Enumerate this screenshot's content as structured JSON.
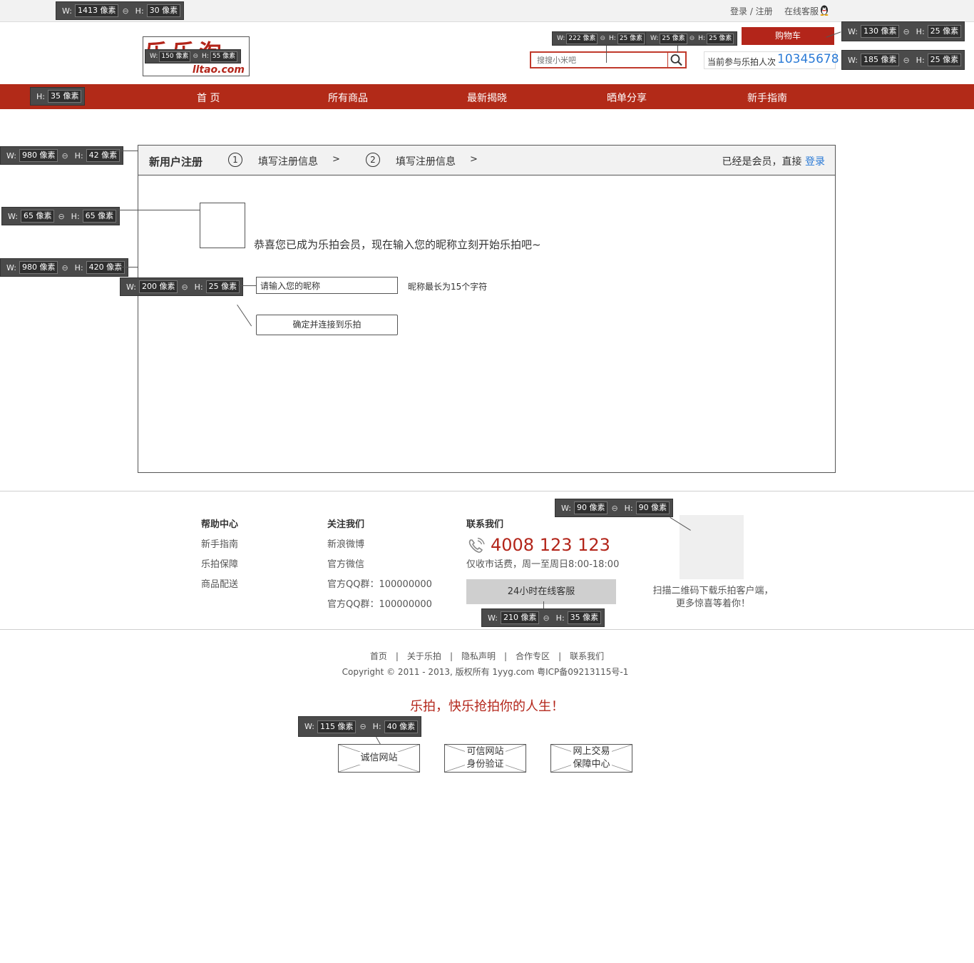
{
  "topbar": {
    "login_register": "登录 / 注册",
    "online_service": "在线客服",
    "qq_icon": "qq-penguin-icon"
  },
  "header": {
    "logo_text": "乐乐淘",
    "logo_domain": "lltao.com",
    "search_placeholder": "搜搜小米吧",
    "search_icon": "magnifier-icon",
    "cart_label": "购物车",
    "count_label": "当前参与乐拍人次",
    "count_value": "10345678"
  },
  "nav": {
    "items": [
      "首 页",
      "所有商品",
      "最新揭晓",
      "晒单分享",
      "新手指南"
    ]
  },
  "register": {
    "title": "新用户注册",
    "steps": [
      {
        "num": "1",
        "label": "填写注册信息",
        "arrow": ">"
      },
      {
        "num": "2",
        "label": "填写注册信息",
        "arrow": ">"
      }
    ],
    "member_note": "已经是会员，直接",
    "login_link": "登录",
    "congrats": "恭喜您已成为乐拍会员，现在输入您的昵称立刻开始乐拍吧~",
    "nickname_value": "请输入您的昵称",
    "nickname_hint": "昵称最长为15个字符",
    "confirm_label": "确定并连接到乐拍"
  },
  "footer": {
    "help": {
      "title": "帮助中心",
      "links": [
        "新手指南",
        "乐拍保障",
        "商品配送"
      ]
    },
    "follow": {
      "title": "关注我们",
      "links": [
        "新浪微博",
        "官方微信",
        "官方QQ群：100000000",
        "官方QQ群：100000000"
      ]
    },
    "contact": {
      "title": "联系我们",
      "phone": "4008 123 123",
      "phone_icon": "phone-icon",
      "note": "仅收市话费，周一至周日8:00-18:00",
      "service_button": "24小时在线客服"
    },
    "qr_text": "扫描二维码下载乐拍客户端，\n更多惊喜等着你！",
    "bottom_links": [
      "首页",
      "关于乐拍",
      "隐私声明",
      "合作专区",
      "联系我们"
    ],
    "separator": "|",
    "copyright": "Copyright © 2011 - 2013, 版权所有 1yyg.com 粤ICP备09213115号-1",
    "slogan": "乐拍，快乐抢拍你的人生！",
    "badges": [
      "诚信网站",
      "可信网站\n身份验证",
      "网上交易\n保障中心"
    ]
  },
  "annotations": {
    "w_label": "W:",
    "h_label": "H:",
    "link_icon": "link-chain-icon",
    "topbar": {
      "w": "1413 像素",
      "h": "30 像素"
    },
    "logo": {
      "w": "150 像素",
      "h": "55 像素"
    },
    "search": {
      "w": "222 像素",
      "h": "25 像素"
    },
    "search_btn": {
      "w": "25 像素",
      "h": "25 像素"
    },
    "cart": {
      "w": "130 像素",
      "h": "25 像素"
    },
    "counter": {
      "w": "185 像素",
      "h": "25 像素"
    },
    "nav": {
      "h": "35 像素"
    },
    "panel_head": {
      "w": "980 像素",
      "h": "42 像素"
    },
    "avatar": {
      "w": "65 像素",
      "h": "65 像素"
    },
    "panel": {
      "w": "980 像素",
      "h": "420 像素"
    },
    "nick_input": {
      "w": "200 像素",
      "h": "25 像素"
    },
    "qr": {
      "w": "90 像素",
      "h": "90 像素"
    },
    "service_btn": {
      "w": "210 像素",
      "h": "35 像素"
    },
    "badge": {
      "w": "115 像素",
      "h": "40 像素"
    }
  }
}
